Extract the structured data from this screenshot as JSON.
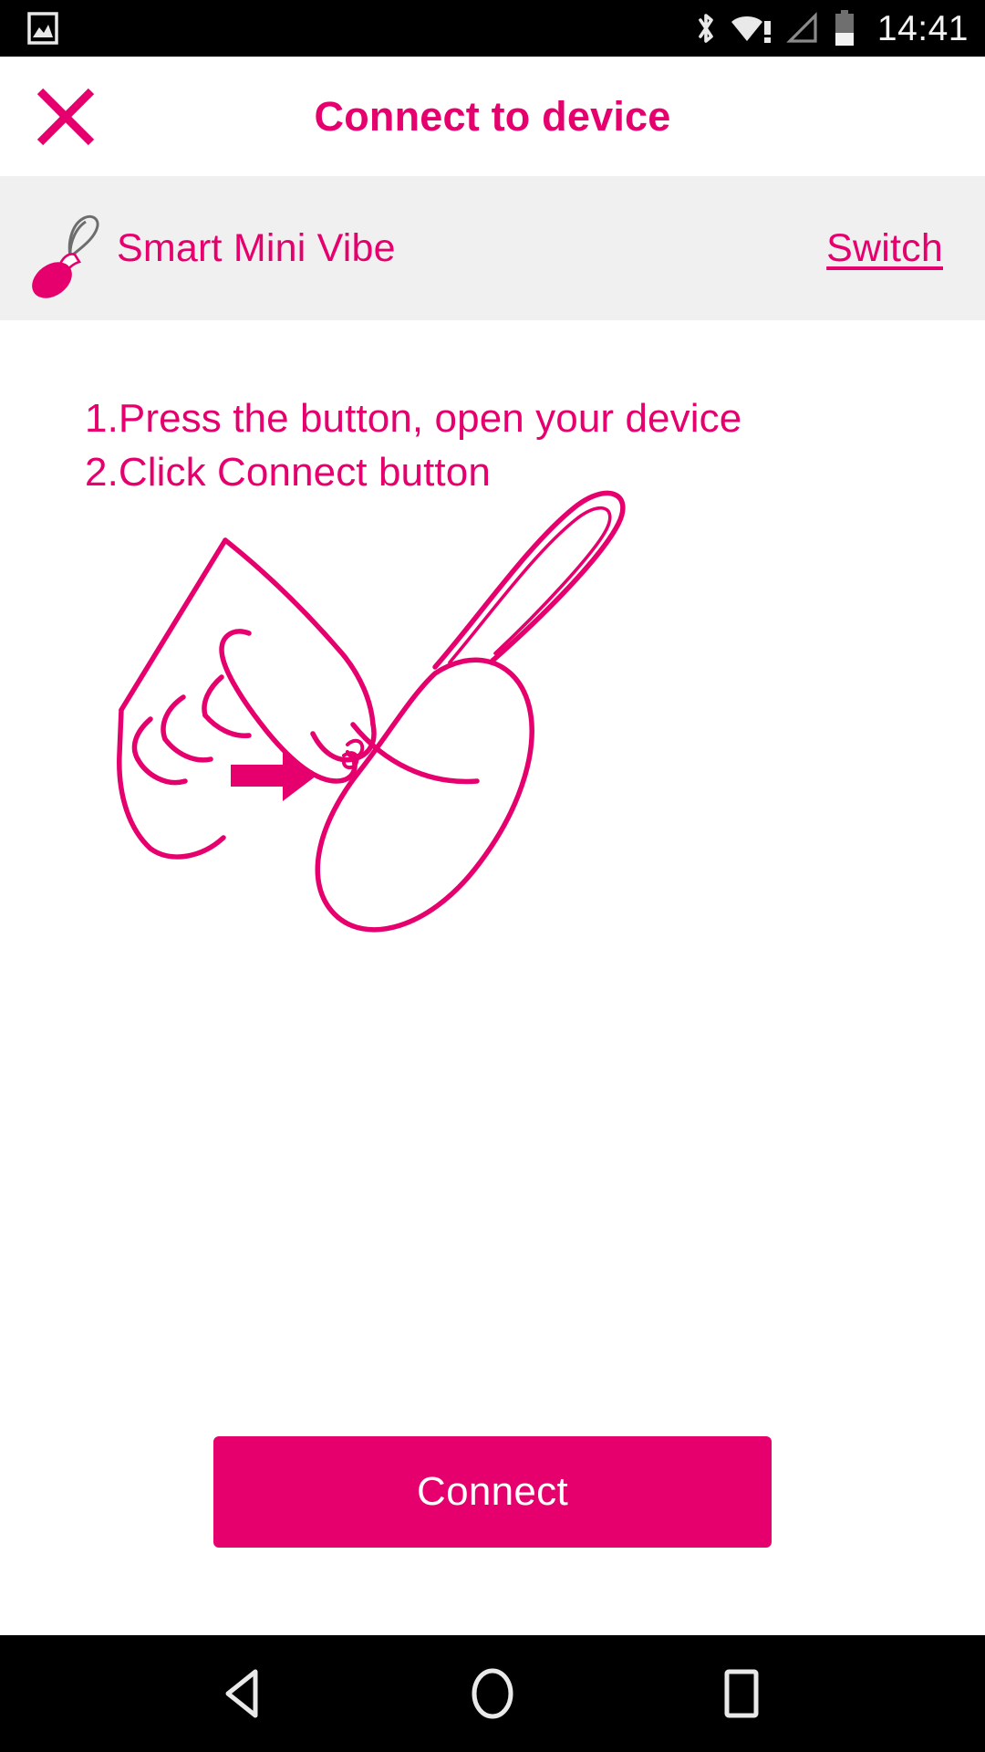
{
  "status_bar": {
    "notification_icon": "image-icon",
    "icons": [
      "bluetooth-icon",
      "wifi-warning-icon",
      "cellular-signal-icon",
      "battery-icon"
    ],
    "battery_level_percent": 40,
    "clock": "14:41"
  },
  "header": {
    "close_icon": "close-icon",
    "title": "Connect to device"
  },
  "device": {
    "icon": "vibe-device-icon",
    "name": "Smart Mini Vibe",
    "switch_label": "Switch"
  },
  "main": {
    "instructions": [
      "1.Press the button, open your device",
      "2.Click Connect button"
    ],
    "illustration": "hand-pressing-device-button-illustration",
    "connect_label": "Connect"
  },
  "nav_bar": {
    "back": "back-triangle-icon",
    "home": "home-circle-icon",
    "recents": "recents-square-icon"
  },
  "colors": {
    "accent_pink": "#e6006e",
    "device_row_bg": "#f0f0f0",
    "status_bar_bg": "#000000",
    "page_bg": "#ffffff"
  }
}
